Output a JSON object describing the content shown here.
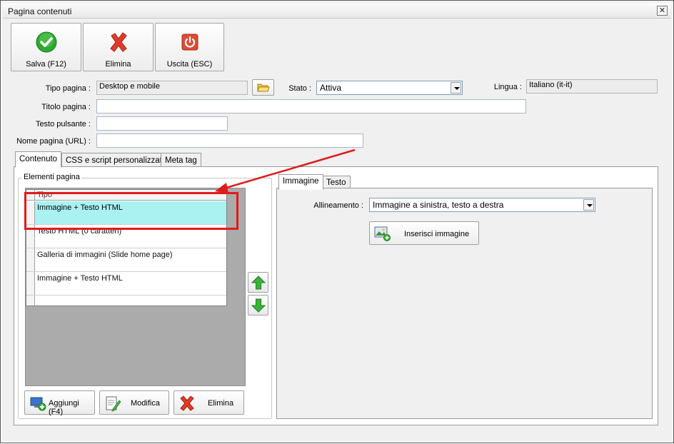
{
  "window": {
    "title": "Pagina contenuti",
    "close_glyph": "✕"
  },
  "toolbar": {
    "save_label": "Salva (F12)",
    "delete_label": "Elimina",
    "exit_label": "Uscita (ESC)",
    "save_icon": "check-icon",
    "delete_icon": "red-x-icon",
    "exit_icon": "power-icon"
  },
  "form": {
    "tipo_pagina_label": "Tipo pagina :",
    "tipo_pagina_value": "Desktop e mobile",
    "stato_label": "Stato :",
    "stato_value": "Attiva",
    "lingua_label": "Lingua :",
    "lingua_value": "Italiano (it-it)",
    "titolo_label": "Titolo pagina :",
    "titolo_value": "",
    "testo_pulsante_label": "Testo pulsante :",
    "testo_pulsante_value": "",
    "nome_pagina_label": "Nome pagina (URL) :",
    "nome_pagina_value": ""
  },
  "tabs": [
    {
      "label": "Contenuto"
    },
    {
      "label": "CSS e script personalizzati"
    },
    {
      "label": "Meta tag"
    }
  ],
  "elements_group": {
    "title": "Elementi pagina",
    "column_header": "Tipo",
    "rows": [
      {
        "tipo": "Immagine + Testo HTML",
        "selected": true
      },
      {
        "tipo": "Testo HTML (0 caratteri)",
        "selected": false
      },
      {
        "tipo": "Galleria di immagini (Slide home page)",
        "selected": false
      },
      {
        "tipo": "Immagine + Testo HTML",
        "selected": false
      }
    ]
  },
  "bottom_buttons": {
    "add_label": "Aggiungi (F4)",
    "edit_label": "Modifica",
    "delete_label": "Elimina"
  },
  "subtabs": [
    {
      "label": "Immagine"
    },
    {
      "label": "Testo"
    }
  ],
  "image_panel": {
    "alignment_label": "Allineamento :",
    "alignment_value": "Immagine a sinistra, testo a destra",
    "insert_image_label": "Inserisci immagine"
  },
  "colors": {
    "selected_row": "#aaf2f2",
    "highlight": "#e11b1b",
    "arrow_green": "#3bb33b"
  }
}
